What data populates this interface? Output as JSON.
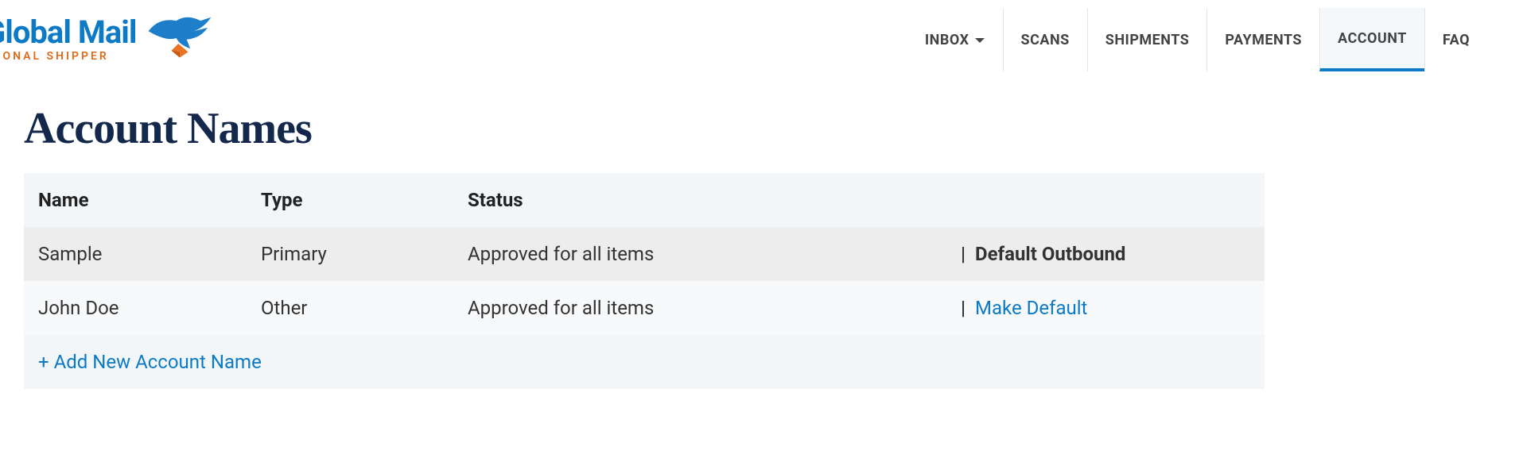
{
  "brand": {
    "main": "Global Mail",
    "sub": "RSONAL SHIPPER"
  },
  "nav": {
    "inbox": "INBOX",
    "scans": "SCANS",
    "shipments": "SHIPMENTS",
    "payments": "PAYMENTS",
    "account": "ACCOUNT",
    "faq": "FAQ"
  },
  "page_title": "Account Names",
  "table": {
    "headers": {
      "name": "Name",
      "type": "Type",
      "status": "Status"
    },
    "rows": [
      {
        "name": "Sample",
        "type": "Primary",
        "status": "Approved for all items",
        "action_label": "Default Outbound",
        "is_default": true
      },
      {
        "name": "John Doe",
        "type": "Other",
        "status": "Approved for all items",
        "action_label": "Make Default",
        "is_default": false
      }
    ],
    "add_label": "+ Add New Account Name"
  },
  "colors": {
    "brand_blue": "#0d7ac6",
    "brand_orange": "#de6a1c",
    "title_navy": "#13284b"
  }
}
